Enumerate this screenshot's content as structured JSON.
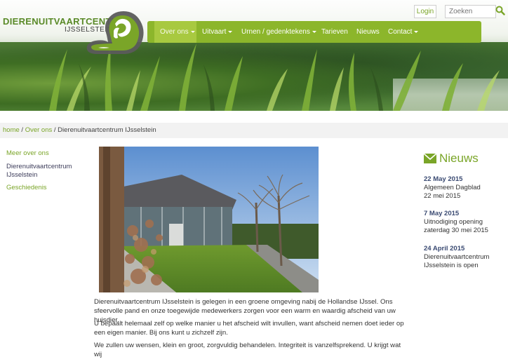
{
  "logo": {
    "title": "DIERENUITVAARTCENTRUM",
    "subtitle": "IJSSELSTEIN"
  },
  "topbar": {
    "login_label": "Login",
    "search_placeholder": "Zoeken"
  },
  "nav": {
    "items": [
      {
        "label": "Over ons",
        "has_dropdown": true,
        "active": true
      },
      {
        "label": "Uitvaart",
        "has_dropdown": true,
        "active": false
      },
      {
        "label": "Urnen / gedenktekens",
        "has_dropdown": true,
        "active": false
      },
      {
        "label": "Tarieven",
        "has_dropdown": false,
        "active": false
      },
      {
        "label": "Nieuws",
        "has_dropdown": false,
        "active": false
      },
      {
        "label": "Contact",
        "has_dropdown": true,
        "active": false
      }
    ]
  },
  "breadcrumb": {
    "home": "home",
    "sep1": " / ",
    "parent": "Over ons",
    "sep2": " / ",
    "current": "Dierenuitvaartcentrum IJsselstein"
  },
  "sidebar": {
    "heading": "Meer over ons",
    "items": [
      {
        "label_line1": "Dierenuitvaartcentrum",
        "label_line2": "IJsselstein"
      },
      {
        "label_line1": "Geschiedenis"
      }
    ]
  },
  "content": {
    "paragraphs": [
      "Dierenuitvaartcentrum IJsselstein is gelegen in een groene omgeving nabij de Hollandse IJssel. Ons sfeervolle pand en onze toegewijde medewerkers zorgen voor een warm en waardig afscheid van uw huisdier.",
      "U bepaalt helemaal zelf op welke manier u het afscheid wilt invullen, want afscheid nemen doet ieder op een eigen manier. Bij ons kunt u zichzelf zijn.",
      "We zullen uw wensen, klein en groot, zorgvuldig behandelen.  Integriteit is vanzelfsprekend. U krijgt wat wij"
    ]
  },
  "news": {
    "heading": "Nieuws",
    "items": [
      {
        "date": "22 May 2015",
        "line1": "Algemeen Dagblad",
        "line2": "22 mei 2015"
      },
      {
        "date": "7 May 2015",
        "line1": "Uitnodiging opening",
        "line2": "zaterdag 30 mei 2015"
      },
      {
        "date": "24 April 2015",
        "line1": "Dierenuitvaartcentrum",
        "line2": "IJsselstein is open"
      }
    ]
  },
  "colors": {
    "brand_green": "#8cb62b",
    "link_green": "#7aa528",
    "news_date": "#3a4a72"
  }
}
